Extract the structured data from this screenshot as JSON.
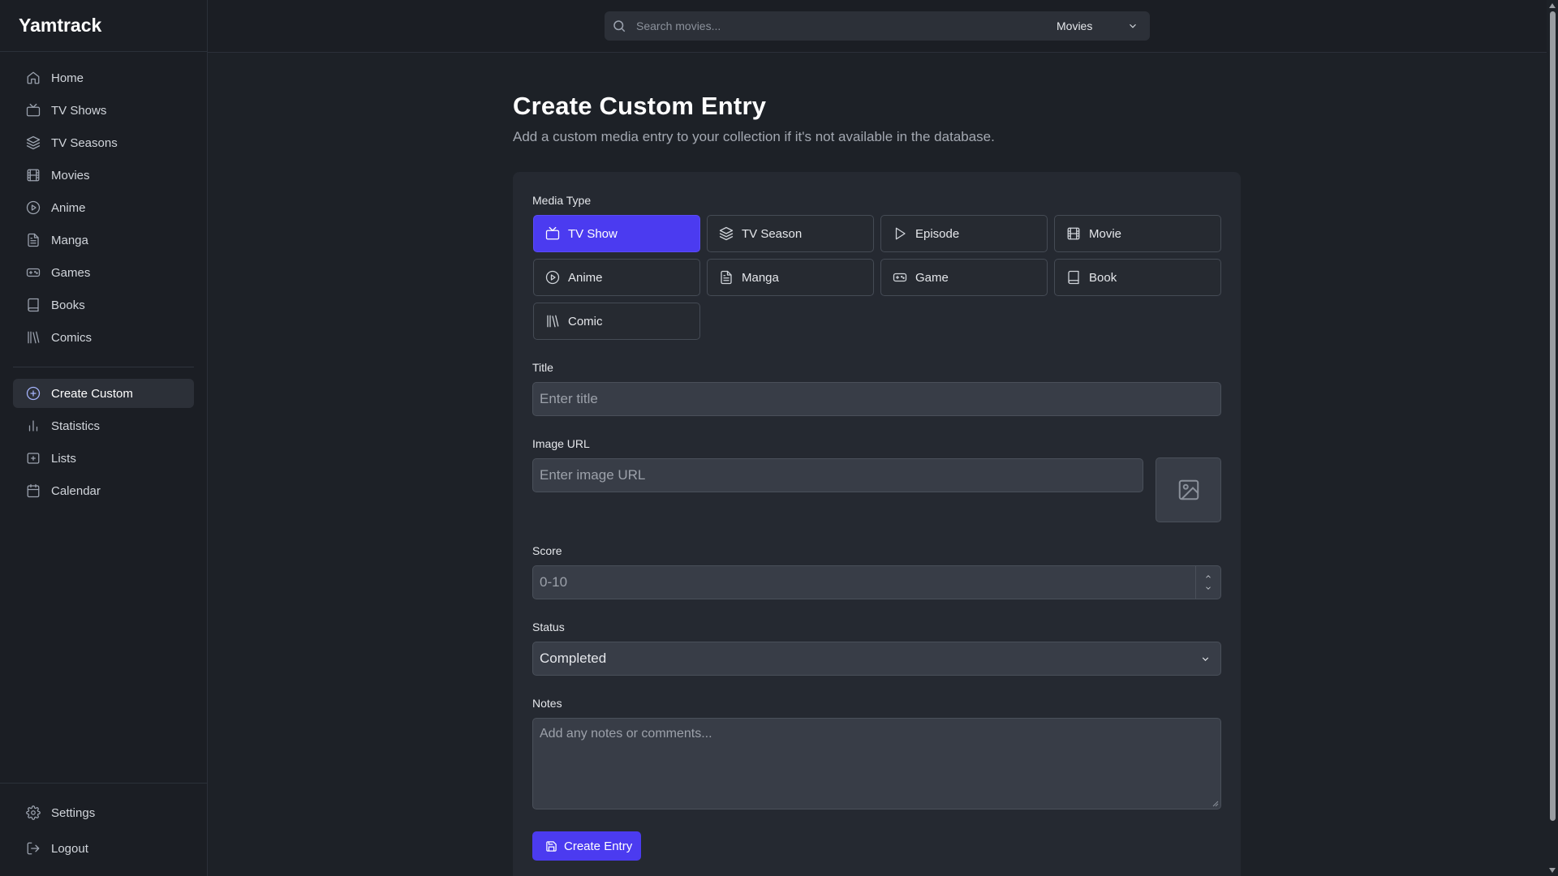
{
  "app": {
    "name": "Yamtrack"
  },
  "sidebar": {
    "items": [
      {
        "label": "Home",
        "icon": "home-icon"
      },
      {
        "label": "TV Shows",
        "icon": "tv-icon"
      },
      {
        "label": "TV Seasons",
        "icon": "layers-icon"
      },
      {
        "label": "Movies",
        "icon": "film-icon"
      },
      {
        "label": "Anime",
        "icon": "play-circle-icon"
      },
      {
        "label": "Manga",
        "icon": "file-text-icon"
      },
      {
        "label": "Games",
        "icon": "gamepad-icon"
      },
      {
        "label": "Books",
        "icon": "book-icon"
      },
      {
        "label": "Comics",
        "icon": "library-icon"
      }
    ],
    "secondary": [
      {
        "label": "Create Custom",
        "icon": "plus-circle-icon",
        "active": true
      },
      {
        "label": "Statistics",
        "icon": "bar-chart-icon"
      },
      {
        "label": "Lists",
        "icon": "folder-plus-icon"
      },
      {
        "label": "Calendar",
        "icon": "calendar-icon"
      }
    ],
    "bottom": [
      {
        "label": "Settings",
        "icon": "gear-icon"
      },
      {
        "label": "Logout",
        "icon": "logout-icon"
      }
    ]
  },
  "search": {
    "placeholder": "Search movies...",
    "type_selected": "Movies"
  },
  "page": {
    "title": "Create Custom Entry",
    "subtitle": "Add a custom media entry to your collection if it's not available in the database."
  },
  "form": {
    "media_type_label": "Media Type",
    "media_types": [
      {
        "label": "TV Show",
        "icon": "tv-icon",
        "selected": true
      },
      {
        "label": "TV Season",
        "icon": "layers-icon"
      },
      {
        "label": "Episode",
        "icon": "play-icon"
      },
      {
        "label": "Movie",
        "icon": "film-icon"
      },
      {
        "label": "Anime",
        "icon": "play-circle-icon"
      },
      {
        "label": "Manga",
        "icon": "file-text-icon"
      },
      {
        "label": "Game",
        "icon": "gamepad-icon"
      },
      {
        "label": "Book",
        "icon": "book-icon"
      },
      {
        "label": "Comic",
        "icon": "library-icon"
      }
    ],
    "title_label": "Title",
    "title_placeholder": "Enter title",
    "image_label": "Image URL",
    "image_placeholder": "Enter image URL",
    "score_label": "Score",
    "score_placeholder": "0-10",
    "status_label": "Status",
    "status_value": "Completed",
    "notes_label": "Notes",
    "notes_placeholder": "Add any notes or comments...",
    "submit_label": "Create Entry"
  },
  "colors": {
    "accent": "#4b3bf0",
    "background": "#1d2127",
    "card": "#252931"
  }
}
